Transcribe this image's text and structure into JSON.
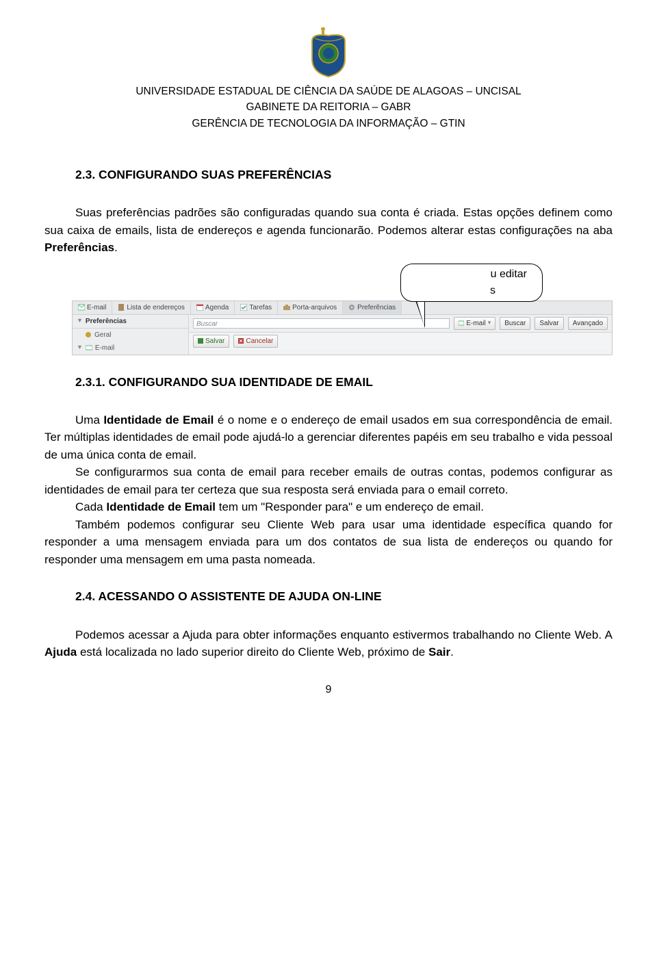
{
  "header": {
    "line1": "UNIVERSIDADE ESTADUAL DE CIÊNCIA DA SAÚDE DE ALAGOAS – UNCISAL",
    "line2": "GABINETE DA REITORIA – GABR",
    "line3": "GERÊNCIA DE TECNOLOGIA DA INFORMAÇÃO – GTIN"
  },
  "section1": {
    "title": "2.3. CONFIGURANDO SUAS PREFERÊNCIAS",
    "p1a": "Suas preferências padrões são configuradas quando sua conta é criada. Estas opções definem como sua caixa de emails, lista de endereços e agenda funcionarão. Podemos alterar estas configurações na aba ",
    "p1b": "Preferências",
    "p1c": "."
  },
  "callout": {
    "line1": "u editar",
    "line2": "s"
  },
  "ui": {
    "tabs": [
      "E-mail",
      "Lista de endereços",
      "Agenda",
      "Tarefas",
      "Porta-arquivos",
      "Preferências"
    ],
    "sidebar": {
      "title": "Preferências",
      "items": [
        "Geral",
        "E-mail"
      ]
    },
    "search_placeholder": "Buscar",
    "search_dropdown": "E-mail",
    "btn_buscar": "Buscar",
    "btn_salvar": "Salvar",
    "btn_avancado": "Avançado",
    "btn_save2": "Salvar",
    "btn_cancel": "Cancelar"
  },
  "section2": {
    "title": "2.3.1. CONFIGURANDO SUA IDENTIDADE DE EMAIL",
    "p1a": "Uma ",
    "p1b": "Identidade de Email",
    "p1c": " é o nome e o endereço de email usados em sua correspondência de email. Ter múltiplas identidades de email pode ajudá-lo a gerenciar diferentes papéis em seu trabalho e vida pessoal de uma única conta de email.",
    "p2": "Se configurarmos sua conta de email para receber emails de outras contas, podemos configurar as identidades de email para ter certeza que sua resposta será enviada para o email correto.",
    "p3a": "Cada ",
    "p3b": "Identidade de Email",
    "p3c": " tem um \"Responder para\" e um endereço de email.",
    "p4": "Também podemos configurar seu Cliente Web para usar uma identidade específica quando for responder a uma mensagem enviada para um dos contatos de sua lista de endereços ou quando for responder uma mensagem em uma pasta nomeada."
  },
  "section3": {
    "title": "2.4. ACESSANDO O ASSISTENTE DE AJUDA ON-LINE",
    "p1a": "Podemos acessar a Ajuda para obter informações enquanto estivermos trabalhando no Cliente Web. A ",
    "p1b": "Ajuda",
    "p1c": " está localizada no lado superior direito do Cliente Web, próximo de ",
    "p1d": "Sair",
    "p1e": "."
  },
  "page_number": "9",
  "colors": {
    "crest_blue": "#1b4f8a",
    "crest_gold": "#c9a227",
    "crest_green": "#2f7d32"
  }
}
